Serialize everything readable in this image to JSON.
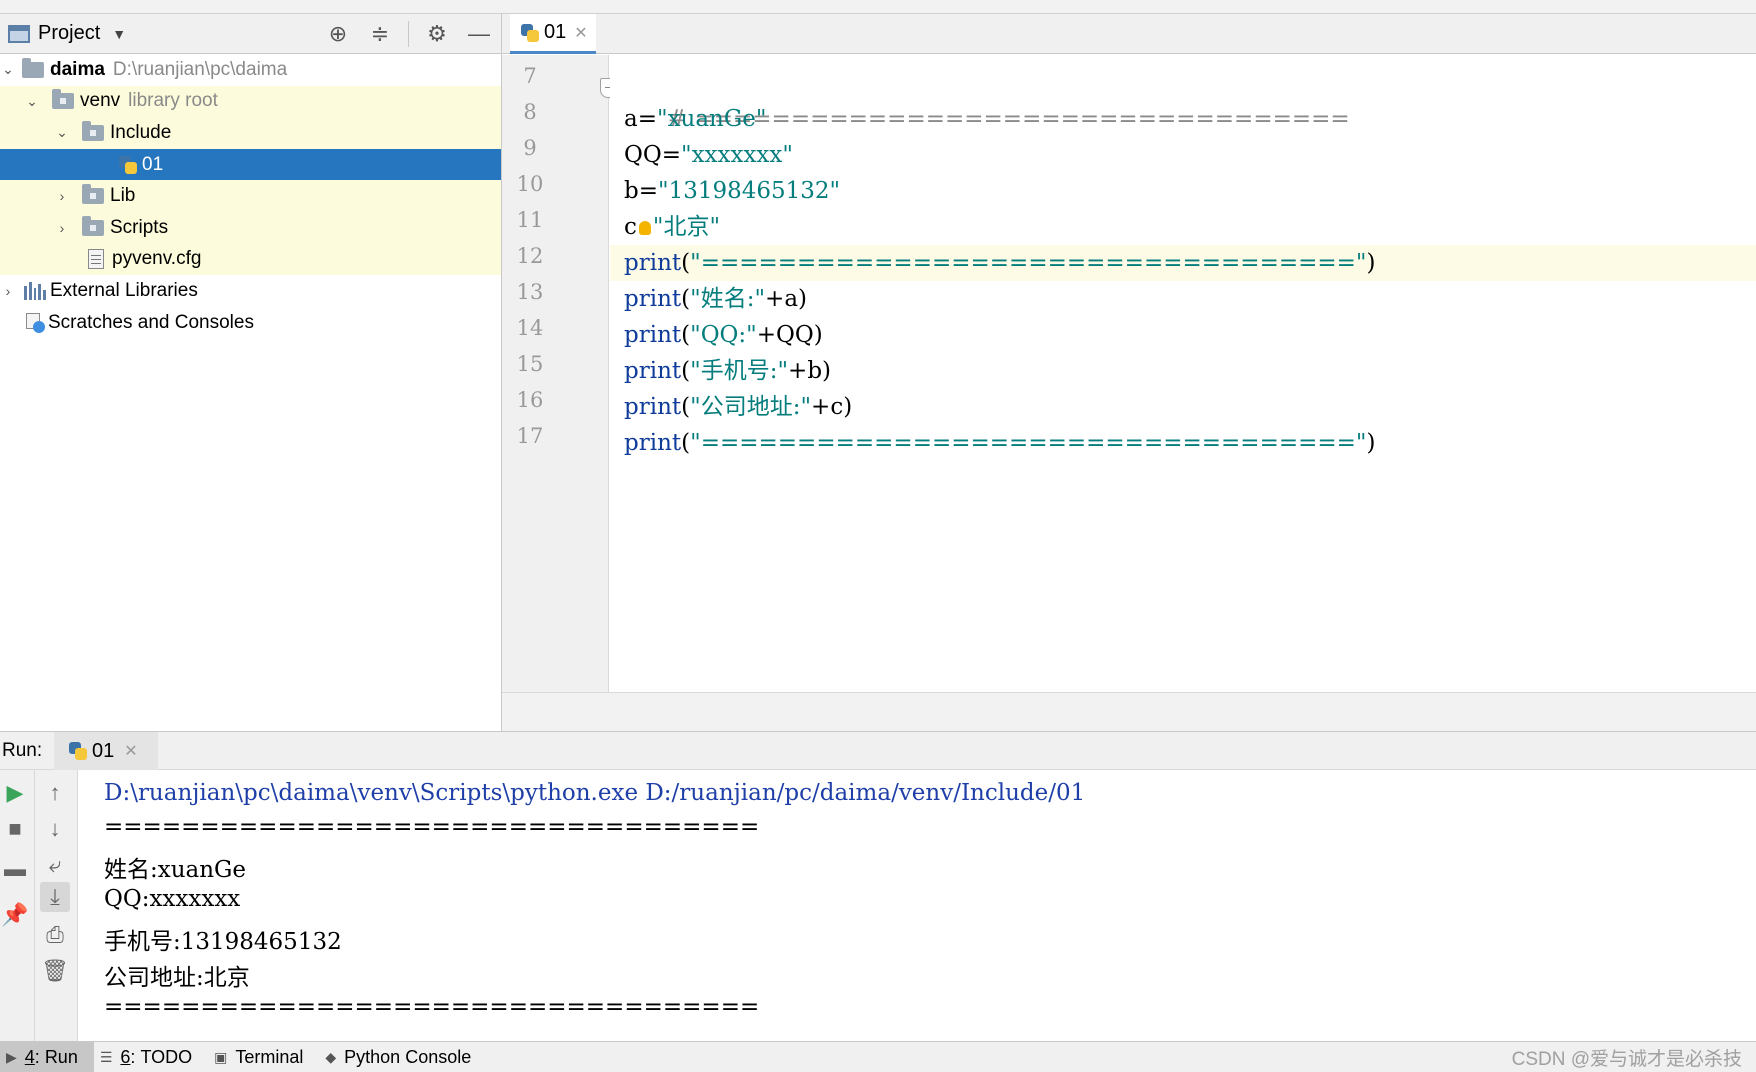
{
  "project_panel": {
    "title": "Project",
    "tree": [
      {
        "label": "daima",
        "hint": "D:\\ruanjian\\pc\\daima"
      },
      {
        "label": "venv",
        "hint": "library root"
      },
      {
        "label": "Include"
      },
      {
        "label": "01"
      },
      {
        "label": "Lib"
      },
      {
        "label": "Scripts"
      },
      {
        "label": "pyvenv.cfg"
      },
      {
        "label": "External Libraries"
      },
      {
        "label": "Scratches and Consoles"
      }
    ]
  },
  "editor": {
    "tab_label": "01",
    "lines": [
      {
        "num": "7",
        "parts": [
          "# =================================="
        ]
      },
      {
        "num": "8",
        "parts": [
          "a=",
          "\"xuanGe\""
        ]
      },
      {
        "num": "9",
        "parts": [
          "QQ=",
          "\"xxxxxxx\""
        ]
      },
      {
        "num": "10",
        "parts": [
          "b=",
          "\"13198465132\""
        ]
      },
      {
        "num": "11",
        "parts": [
          "c",
          "=",
          "\"北京\""
        ]
      },
      {
        "num": "12",
        "parts": [
          "print",
          "(",
          "\"==================================\"",
          ")"
        ]
      },
      {
        "num": "13",
        "parts": [
          "print",
          "(",
          "\"姓名:\"",
          "+a)"
        ]
      },
      {
        "num": "14",
        "parts": [
          "print",
          "(",
          "\"QQ:\"",
          "+QQ)"
        ]
      },
      {
        "num": "15",
        "parts": [
          "print",
          "(",
          "\"手机号:\"",
          "+b)"
        ]
      },
      {
        "num": "16",
        "parts": [
          "print",
          "(",
          "\"公司地址:\"",
          "+c)"
        ]
      },
      {
        "num": "17",
        "parts": [
          "print",
          "(",
          "\"==================================\"",
          ")"
        ]
      }
    ]
  },
  "run_panel": {
    "label": "Run:",
    "tab_label": "01",
    "output": [
      "D:\\ruanjian\\pc\\daima\\venv\\Scripts\\python.exe D:/ruanjian/pc/daima/venv/Include/01",
      "==================================",
      "姓名:xuanGe",
      "QQ:xxxxxxx",
      "手机号:13198465132",
      "公司地址:北京",
      "=================================="
    ]
  },
  "status_bar": {
    "items": [
      {
        "key": "4",
        "label": "Run"
      },
      {
        "key": "6",
        "label": "TODO"
      },
      {
        "label": "Terminal"
      },
      {
        "label": "Python Console"
      }
    ],
    "watermark": "CSDN @爱与诚才是必杀技"
  },
  "colors": {
    "selection": "#2675bf",
    "library_bg": "#fcfcdc",
    "string": "#067d7d",
    "function": "#0f3b9a",
    "console_cmd": "#1f3fa8"
  }
}
